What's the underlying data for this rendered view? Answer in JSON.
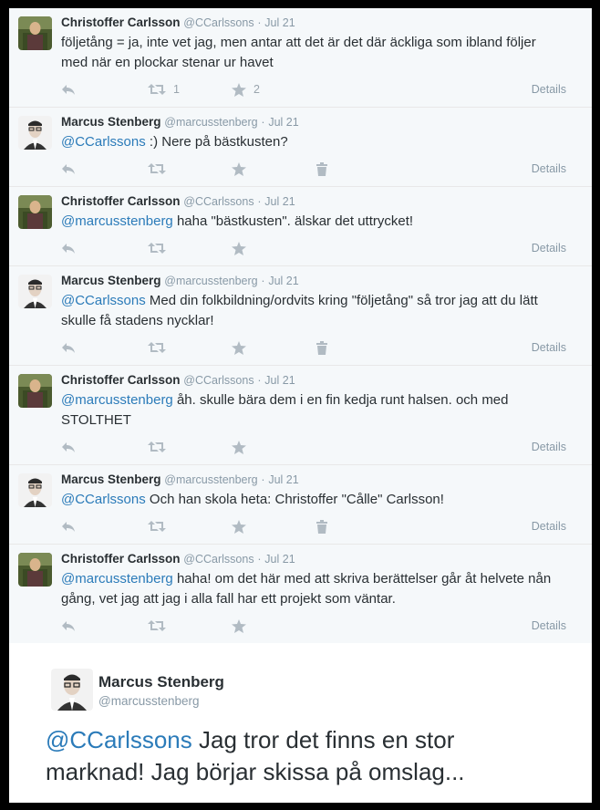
{
  "tweets": [
    {
      "name": "Christoffer Carlsson",
      "handle": "@CCarlssons",
      "time": "Jul 21",
      "mention": "",
      "body": "följetång = ja, inte vet jag, men antar att det är det där äckliga som ibland följer med när en plockar stenar ur havet",
      "retweets": "1",
      "favorites": "2",
      "details": "Details"
    },
    {
      "name": "Marcus Stenberg",
      "handle": "@marcusstenberg",
      "time": "Jul 21",
      "mention": "@CCarlssons",
      "body": " :) Nere på bästkusten?",
      "retweets": "",
      "favorites": "",
      "details": "Details"
    },
    {
      "name": "Christoffer Carlsson",
      "handle": "@CCarlssons",
      "time": "Jul 21",
      "mention": "@marcusstenberg",
      "body": " haha \"bästkusten\". älskar det uttrycket!",
      "retweets": "",
      "favorites": "",
      "details": "Details"
    },
    {
      "name": "Marcus Stenberg",
      "handle": "@marcusstenberg",
      "time": "Jul 21",
      "mention": "@CCarlssons",
      "body": " Med din folkbildning/ordvits kring \"följetång\" så tror jag att du lätt skulle få stadens nycklar!",
      "retweets": "",
      "favorites": "",
      "details": "Details"
    },
    {
      "name": "Christoffer Carlsson",
      "handle": "@CCarlssons",
      "time": "Jul 21",
      "mention": "@marcusstenberg",
      "body": " åh. skulle bära dem i en fin kedja runt halsen. och med STOLTHET",
      "retweets": "",
      "favorites": "",
      "details": "Details"
    },
    {
      "name": "Marcus Stenberg",
      "handle": "@marcusstenberg",
      "time": "Jul 21",
      "mention": "@CCarlssons",
      "body": " Och han skola heta: Christoffer \"Cålle\" Carlsson!",
      "retweets": "",
      "favorites": "",
      "details": "Details"
    },
    {
      "name": "Christoffer Carlsson",
      "handle": "@CCarlssons",
      "time": "Jul 21",
      "mention": "@marcusstenberg",
      "body": " haha! om det här med att skriva berättelser går åt helvete nån gång, vet jag att jag i alla fall har ett projekt som väntar.",
      "retweets": "",
      "favorites": "",
      "details": "Details"
    }
  ],
  "main_tweet": {
    "name": "Marcus Stenberg",
    "handle": "@marcusstenberg",
    "mention": "@CCarlssons",
    "body": " Jag tror det finns en stor marknad! Jag börjar skissa på omslag..."
  },
  "separator": "·",
  "colors": {
    "link": "#2b7bb9",
    "text": "#292f33",
    "muted": "#8899a6",
    "reply_bg": "#f5f8fa"
  }
}
